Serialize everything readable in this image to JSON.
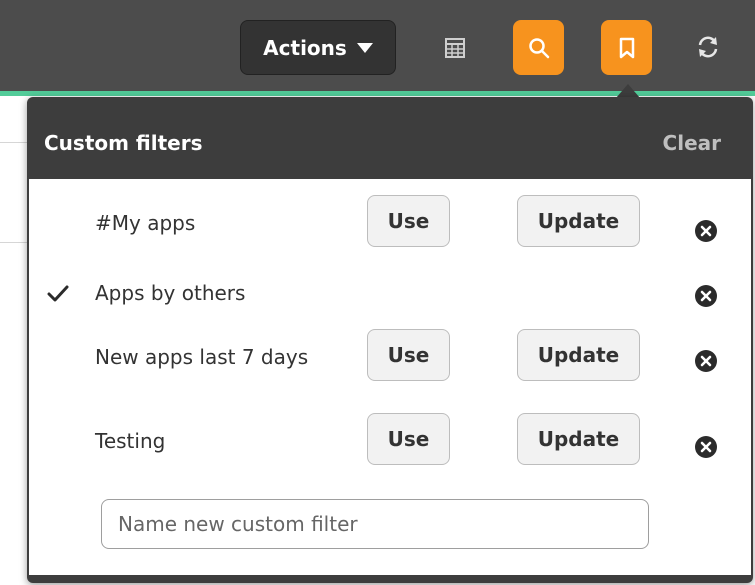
{
  "toolbar": {
    "actions_label": "Actions",
    "icons": [
      "table-icon",
      "search-icon",
      "bookmark-icon",
      "sync-icon"
    ],
    "colors": {
      "bar": "#4c4c4c",
      "accent": "#52cc99",
      "orange": "#f7931e"
    }
  },
  "popover": {
    "title": "Custom filters",
    "clear_label": "Clear",
    "filters": [
      {
        "label": "#My apps",
        "use": "Use",
        "update": "Update",
        "selected": false
      },
      {
        "label": "Apps by others",
        "selected": true
      },
      {
        "label": "New apps last 7 days",
        "use": "Use",
        "update": "Update",
        "selected": false
      },
      {
        "label": "Testing",
        "use": "Use",
        "update": "Update",
        "selected": false
      }
    ],
    "new_filter_placeholder": "Name new custom filter"
  }
}
